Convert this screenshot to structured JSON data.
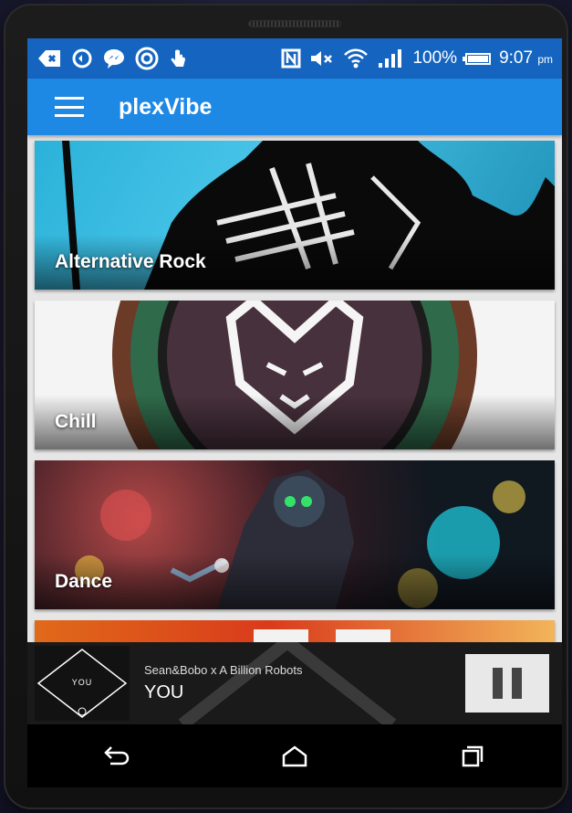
{
  "status": {
    "battery_pct": "100%",
    "time": "9:07",
    "ampm": "pm",
    "icons_left": [
      "notification-icon",
      "sync-icon",
      "messenger-icon",
      "camera-icon",
      "touch-icon"
    ],
    "icons_right": [
      "nfc-icon",
      "mute-icon",
      "wifi-icon",
      "signal-icon",
      "battery-icon"
    ]
  },
  "appbar": {
    "title": "plexVibe",
    "color": "#1e88e5",
    "status_color": "#1565c0"
  },
  "genres": [
    {
      "label": "Alternative Rock"
    },
    {
      "label": "Chill"
    },
    {
      "label": "Dance"
    },
    {
      "label": ""
    }
  ],
  "now_playing": {
    "artist": "Sean&Bobo x A Billion Robots",
    "title": "YOU",
    "album_text": "YOU",
    "state": "playing"
  },
  "navigation": [
    "back-icon",
    "home-icon",
    "recents-icon"
  ]
}
